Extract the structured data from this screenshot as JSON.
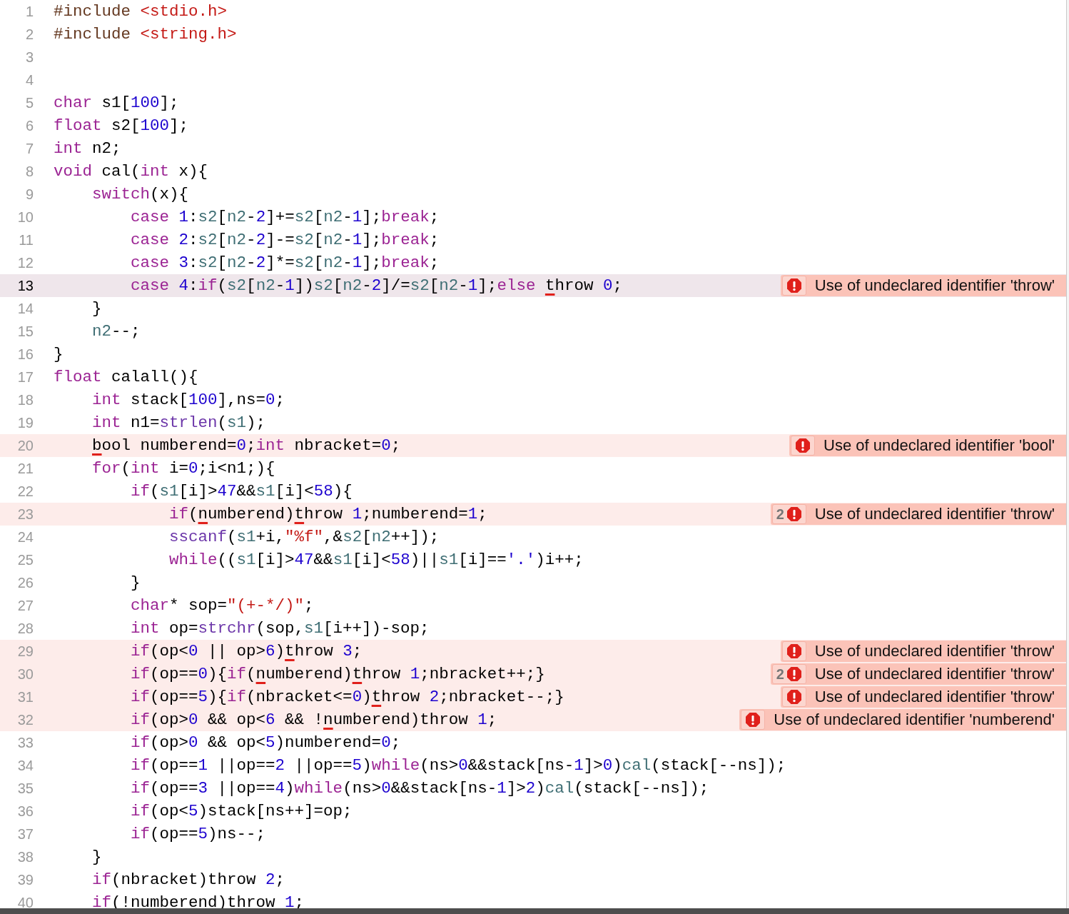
{
  "lines": [
    {
      "number": "1",
      "current": false,
      "tokens": [
        {
          "kind": "pp",
          "text": "#include "
        },
        {
          "kind": "str",
          "text": "<stdio.h>"
        }
      ]
    },
    {
      "number": "2",
      "current": false,
      "tokens": [
        {
          "kind": "pp",
          "text": "#include "
        },
        {
          "kind": "str",
          "text": "<string.h>"
        }
      ]
    },
    {
      "number": "3",
      "current": false
    },
    {
      "number": "4",
      "current": false
    },
    {
      "number": "5",
      "current": false,
      "tokens": [
        {
          "kind": "kw",
          "text": "char"
        },
        {
          "kind": "plain",
          "text": " s1["
        },
        {
          "kind": "num",
          "text": "100"
        },
        {
          "kind": "plain",
          "text": "];"
        }
      ]
    },
    {
      "number": "6",
      "current": false,
      "tokens": [
        {
          "kind": "kw",
          "text": "float"
        },
        {
          "kind": "plain",
          "text": " s2["
        },
        {
          "kind": "num",
          "text": "100"
        },
        {
          "kind": "plain",
          "text": "];"
        }
      ]
    },
    {
      "number": "7",
      "current": false,
      "tokens": [
        {
          "kind": "kw",
          "text": "int"
        },
        {
          "kind": "plain",
          "text": " n2;"
        }
      ]
    },
    {
      "number": "8",
      "current": false,
      "tokens": [
        {
          "kind": "kw",
          "text": "void"
        },
        {
          "kind": "plain",
          "text": " cal("
        },
        {
          "kind": "kw",
          "text": "int"
        },
        {
          "kind": "plain",
          "text": " x){"
        }
      ]
    },
    {
      "number": "9",
      "current": false,
      "tokens": [
        {
          "kind": "kw",
          "text": "    switch"
        },
        {
          "kind": "plain",
          "text": "(x){"
        }
      ]
    },
    {
      "number": "10",
      "current": false,
      "tokens": [
        {
          "kind": "kw",
          "text": "        case "
        },
        {
          "kind": "num",
          "text": "1"
        },
        {
          "kind": "plain",
          "text": ":"
        },
        {
          "kind": "id",
          "text": "s2"
        },
        {
          "kind": "plain",
          "text": "["
        },
        {
          "kind": "id",
          "text": "n2"
        },
        {
          "kind": "plain",
          "text": "-"
        },
        {
          "kind": "num",
          "text": "2"
        },
        {
          "kind": "plain",
          "text": "]+="
        },
        {
          "kind": "id",
          "text": "s2"
        },
        {
          "kind": "plain",
          "text": "["
        },
        {
          "kind": "id",
          "text": "n2"
        },
        {
          "kind": "plain",
          "text": "-"
        },
        {
          "kind": "num",
          "text": "1"
        },
        {
          "kind": "plain",
          "text": "];"
        },
        {
          "kind": "kw",
          "text": "break"
        },
        {
          "kind": "plain",
          "text": ";"
        }
      ]
    },
    {
      "number": "11",
      "current": false,
      "tokens": [
        {
          "kind": "kw",
          "text": "        case "
        },
        {
          "kind": "num",
          "text": "2"
        },
        {
          "kind": "plain",
          "text": ":"
        },
        {
          "kind": "id",
          "text": "s2"
        },
        {
          "kind": "plain",
          "text": "["
        },
        {
          "kind": "id",
          "text": "n2"
        },
        {
          "kind": "plain",
          "text": "-"
        },
        {
          "kind": "num",
          "text": "2"
        },
        {
          "kind": "plain",
          "text": "]-="
        },
        {
          "kind": "id",
          "text": "s2"
        },
        {
          "kind": "plain",
          "text": "["
        },
        {
          "kind": "id",
          "text": "n2"
        },
        {
          "kind": "plain",
          "text": "-"
        },
        {
          "kind": "num",
          "text": "1"
        },
        {
          "kind": "plain",
          "text": "];"
        },
        {
          "kind": "kw",
          "text": "break"
        },
        {
          "kind": "plain",
          "text": ";"
        }
      ]
    },
    {
      "number": "12",
      "current": false,
      "tokens": [
        {
          "kind": "kw",
          "text": "        case "
        },
        {
          "kind": "num",
          "text": "3"
        },
        {
          "kind": "plain",
          "text": ":"
        },
        {
          "kind": "id",
          "text": "s2"
        },
        {
          "kind": "plain",
          "text": "["
        },
        {
          "kind": "id",
          "text": "n2"
        },
        {
          "kind": "plain",
          "text": "-"
        },
        {
          "kind": "num",
          "text": "2"
        },
        {
          "kind": "plain",
          "text": "]*="
        },
        {
          "kind": "id",
          "text": "s2"
        },
        {
          "kind": "plain",
          "text": "["
        },
        {
          "kind": "id",
          "text": "n2"
        },
        {
          "kind": "plain",
          "text": "-"
        },
        {
          "kind": "num",
          "text": "1"
        },
        {
          "kind": "plain",
          "text": "];"
        },
        {
          "kind": "kw",
          "text": "break"
        },
        {
          "kind": "plain",
          "text": ";"
        }
      ]
    },
    {
      "number": "13",
      "current": true,
      "error": {
        "message": "Use of undeclared identifier 'throw'"
      },
      "tokens": [
        {
          "kind": "kw",
          "text": "        case "
        },
        {
          "kind": "num",
          "text": "4"
        },
        {
          "kind": "plain",
          "text": ":"
        },
        {
          "kind": "kw",
          "text": "if"
        },
        {
          "kind": "plain",
          "text": "("
        },
        {
          "kind": "id",
          "text": "s2"
        },
        {
          "kind": "plain",
          "text": "["
        },
        {
          "kind": "id",
          "text": "n2"
        },
        {
          "kind": "plain",
          "text": "-"
        },
        {
          "kind": "num",
          "text": "1"
        },
        {
          "kind": "plain",
          "text": "])"
        },
        {
          "kind": "id",
          "text": "s2"
        },
        {
          "kind": "plain",
          "text": "["
        },
        {
          "kind": "id",
          "text": "n2"
        },
        {
          "kind": "plain",
          "text": "-"
        },
        {
          "kind": "num",
          "text": "2"
        },
        {
          "kind": "plain",
          "text": "]/="
        },
        {
          "kind": "id",
          "text": "s2"
        },
        {
          "kind": "plain",
          "text": "["
        },
        {
          "kind": "id",
          "text": "n2"
        },
        {
          "kind": "plain",
          "text": "-"
        },
        {
          "kind": "num",
          "text": "1"
        },
        {
          "kind": "plain",
          "text": "];"
        },
        {
          "kind": "kw",
          "text": "else "
        },
        {
          "kind": "flag",
          "text": "t"
        },
        {
          "kind": "plain",
          "text": "hrow "
        },
        {
          "kind": "num",
          "text": "0"
        },
        {
          "kind": "plain",
          "text": ";"
        }
      ]
    },
    {
      "number": "14",
      "current": false,
      "tokens": [
        {
          "kind": "plain",
          "text": "    }"
        }
      ]
    },
    {
      "number": "15",
      "current": false,
      "tokens": [
        {
          "kind": "id",
          "text": "    n2"
        },
        {
          "kind": "plain",
          "text": "--;"
        }
      ]
    },
    {
      "number": "16",
      "current": false,
      "tokens": [
        {
          "kind": "plain",
          "text": "}"
        }
      ]
    },
    {
      "number": "17",
      "current": false,
      "tokens": [
        {
          "kind": "kw",
          "text": "float"
        },
        {
          "kind": "plain",
          "text": " calall(){"
        }
      ]
    },
    {
      "number": "18",
      "current": false,
      "tokens": [
        {
          "kind": "kw",
          "text": "    int"
        },
        {
          "kind": "plain",
          "text": " stack["
        },
        {
          "kind": "num",
          "text": "100"
        },
        {
          "kind": "plain",
          "text": "],ns="
        },
        {
          "kind": "num",
          "text": "0"
        },
        {
          "kind": "plain",
          "text": ";"
        }
      ]
    },
    {
      "number": "19",
      "current": false,
      "tokens": [
        {
          "kind": "kw",
          "text": "    int"
        },
        {
          "kind": "plain",
          "text": " n1="
        },
        {
          "kind": "fn",
          "text": "strlen"
        },
        {
          "kind": "plain",
          "text": "("
        },
        {
          "kind": "id",
          "text": "s1"
        },
        {
          "kind": "plain",
          "text": ");"
        }
      ]
    },
    {
      "number": "20",
      "current": false,
      "error": {
        "message": "Use of undeclared identifier 'bool'"
      },
      "tokens": [
        {
          "kind": "flag",
          "text": "    b"
        },
        {
          "kind": "plain",
          "text": "ool numberend="
        },
        {
          "kind": "num",
          "text": "0"
        },
        {
          "kind": "plain",
          "text": ";"
        },
        {
          "kind": "kw",
          "text": "int"
        },
        {
          "kind": "plain",
          "text": " nbracket="
        },
        {
          "kind": "num",
          "text": "0"
        },
        {
          "kind": "plain",
          "text": ";"
        }
      ]
    },
    {
      "number": "21",
      "current": false,
      "tokens": [
        {
          "kind": "kw",
          "text": "    for"
        },
        {
          "kind": "plain",
          "text": "("
        },
        {
          "kind": "kw",
          "text": "int"
        },
        {
          "kind": "plain",
          "text": " i="
        },
        {
          "kind": "num",
          "text": "0"
        },
        {
          "kind": "plain",
          "text": ";i<n1;){"
        }
      ]
    },
    {
      "number": "22",
      "current": false,
      "tokens": [
        {
          "kind": "kw",
          "text": "        if"
        },
        {
          "kind": "plain",
          "text": "("
        },
        {
          "kind": "id",
          "text": "s1"
        },
        {
          "kind": "plain",
          "text": "[i]>"
        },
        {
          "kind": "num",
          "text": "47"
        },
        {
          "kind": "plain",
          "text": "&&"
        },
        {
          "kind": "id",
          "text": "s1"
        },
        {
          "kind": "plain",
          "text": "[i]<"
        },
        {
          "kind": "num",
          "text": "58"
        },
        {
          "kind": "plain",
          "text": "){"
        }
      ]
    },
    {
      "number": "23",
      "current": false,
      "error": {
        "count": "2",
        "message": "Use of undeclared identifier 'throw'"
      },
      "tokens": [
        {
          "kind": "kw",
          "text": "            if"
        },
        {
          "kind": "plain",
          "text": "("
        },
        {
          "kind": "flag",
          "text": "n"
        },
        {
          "kind": "plain",
          "text": "umberend)"
        },
        {
          "kind": "flag",
          "text": "t"
        },
        {
          "kind": "plain",
          "text": "hrow "
        },
        {
          "kind": "num",
          "text": "1"
        },
        {
          "kind": "plain",
          "text": ";numberend="
        },
        {
          "kind": "num",
          "text": "1"
        },
        {
          "kind": "plain",
          "text": ";"
        }
      ]
    },
    {
      "number": "24",
      "current": false,
      "tokens": [
        {
          "kind": "fn",
          "text": "            sscanf"
        },
        {
          "kind": "plain",
          "text": "("
        },
        {
          "kind": "id",
          "text": "s1"
        },
        {
          "kind": "plain",
          "text": "+i,"
        },
        {
          "kind": "str",
          "text": "\"%f\""
        },
        {
          "kind": "plain",
          "text": ",&"
        },
        {
          "kind": "id",
          "text": "s2"
        },
        {
          "kind": "plain",
          "text": "["
        },
        {
          "kind": "id",
          "text": "n2"
        },
        {
          "kind": "plain",
          "text": "++]);"
        }
      ]
    },
    {
      "number": "25",
      "current": false,
      "tokens": [
        {
          "kind": "kw",
          "text": "            while"
        },
        {
          "kind": "plain",
          "text": "(("
        },
        {
          "kind": "id",
          "text": "s1"
        },
        {
          "kind": "plain",
          "text": "[i]>"
        },
        {
          "kind": "num",
          "text": "47"
        },
        {
          "kind": "plain",
          "text": "&&"
        },
        {
          "kind": "id",
          "text": "s1"
        },
        {
          "kind": "plain",
          "text": "[i]<"
        },
        {
          "kind": "num",
          "text": "58"
        },
        {
          "kind": "plain",
          "text": ")||"
        },
        {
          "kind": "id",
          "text": "s1"
        },
        {
          "kind": "plain",
          "text": "[i]=="
        },
        {
          "kind": "char",
          "text": "'.'"
        },
        {
          "kind": "plain",
          "text": ")i++;"
        }
      ]
    },
    {
      "number": "26",
      "current": false,
      "tokens": [
        {
          "kind": "plain",
          "text": "        }"
        }
      ]
    },
    {
      "number": "27",
      "current": false,
      "tokens": [
        {
          "kind": "kw",
          "text": "        char"
        },
        {
          "kind": "plain",
          "text": "* sop="
        },
        {
          "kind": "str",
          "text": "\"(+-*/)\""
        },
        {
          "kind": "plain",
          "text": ";"
        }
      ]
    },
    {
      "number": "28",
      "current": false,
      "tokens": [
        {
          "kind": "kw",
          "text": "        int"
        },
        {
          "kind": "plain",
          "text": " op="
        },
        {
          "kind": "fn",
          "text": "strchr"
        },
        {
          "kind": "plain",
          "text": "(sop,"
        },
        {
          "kind": "id",
          "text": "s1"
        },
        {
          "kind": "plain",
          "text": "[i++])-sop;"
        }
      ]
    },
    {
      "number": "29",
      "current": false,
      "error": {
        "message": "Use of undeclared identifier 'throw'"
      },
      "tokens": [
        {
          "kind": "kw",
          "text": "        if"
        },
        {
          "kind": "plain",
          "text": "(op<"
        },
        {
          "kind": "num",
          "text": "0"
        },
        {
          "kind": "plain",
          "text": " || op>"
        },
        {
          "kind": "num",
          "text": "6"
        },
        {
          "kind": "plain",
          "text": ")"
        },
        {
          "kind": "flag",
          "text": "t"
        },
        {
          "kind": "plain",
          "text": "hrow "
        },
        {
          "kind": "num",
          "text": "3"
        },
        {
          "kind": "plain",
          "text": ";"
        }
      ]
    },
    {
      "number": "30",
      "current": false,
      "error": {
        "count": "2",
        "message": "Use of undeclared identifier 'throw'"
      },
      "tokens": [
        {
          "kind": "kw",
          "text": "        if"
        },
        {
          "kind": "plain",
          "text": "(op=="
        },
        {
          "kind": "num",
          "text": "0"
        },
        {
          "kind": "plain",
          "text": "){"
        },
        {
          "kind": "kw",
          "text": "if"
        },
        {
          "kind": "plain",
          "text": "("
        },
        {
          "kind": "flag",
          "text": "n"
        },
        {
          "kind": "plain",
          "text": "umberend)"
        },
        {
          "kind": "flag",
          "text": "t"
        },
        {
          "kind": "plain",
          "text": "hrow "
        },
        {
          "kind": "num",
          "text": "1"
        },
        {
          "kind": "plain",
          "text": ";nbracket++;}"
        }
      ]
    },
    {
      "number": "31",
      "current": false,
      "error": {
        "message": "Use of undeclared identifier 'throw'"
      },
      "tokens": [
        {
          "kind": "kw",
          "text": "        if"
        },
        {
          "kind": "plain",
          "text": "(op=="
        },
        {
          "kind": "num",
          "text": "5"
        },
        {
          "kind": "plain",
          "text": "){"
        },
        {
          "kind": "kw",
          "text": "if"
        },
        {
          "kind": "plain",
          "text": "(nbracket<="
        },
        {
          "kind": "num",
          "text": "0"
        },
        {
          "kind": "plain",
          "text": ")"
        },
        {
          "kind": "flag",
          "text": "t"
        },
        {
          "kind": "plain",
          "text": "hrow "
        },
        {
          "kind": "num",
          "text": "2"
        },
        {
          "kind": "plain",
          "text": ";nbracket--;}"
        }
      ]
    },
    {
      "number": "32",
      "current": false,
      "error": {
        "message": "Use of undeclared identifier 'numberend'"
      },
      "tokens": [
        {
          "kind": "kw",
          "text": "        if"
        },
        {
          "kind": "plain",
          "text": "(op>"
        },
        {
          "kind": "num",
          "text": "0"
        },
        {
          "kind": "plain",
          "text": " && op<"
        },
        {
          "kind": "num",
          "text": "6"
        },
        {
          "kind": "plain",
          "text": " && !"
        },
        {
          "kind": "flag",
          "text": "n"
        },
        {
          "kind": "plain",
          "text": "umberend)throw "
        },
        {
          "kind": "num",
          "text": "1"
        },
        {
          "kind": "plain",
          "text": ";"
        }
      ]
    },
    {
      "number": "33",
      "current": false,
      "tokens": [
        {
          "kind": "kw",
          "text": "        if"
        },
        {
          "kind": "plain",
          "text": "(op>"
        },
        {
          "kind": "num",
          "text": "0"
        },
        {
          "kind": "plain",
          "text": " && op<"
        },
        {
          "kind": "num",
          "text": "5"
        },
        {
          "kind": "plain",
          "text": ")numberend="
        },
        {
          "kind": "num",
          "text": "0"
        },
        {
          "kind": "plain",
          "text": ";"
        }
      ]
    },
    {
      "number": "34",
      "current": false,
      "tokens": [
        {
          "kind": "kw",
          "text": "        if"
        },
        {
          "kind": "plain",
          "text": "(op=="
        },
        {
          "kind": "num",
          "text": "1"
        },
        {
          "kind": "plain",
          "text": " ||op=="
        },
        {
          "kind": "num",
          "text": "2"
        },
        {
          "kind": "plain",
          "text": " ||op=="
        },
        {
          "kind": "num",
          "text": "5"
        },
        {
          "kind": "plain",
          "text": ")"
        },
        {
          "kind": "kw",
          "text": "while"
        },
        {
          "kind": "plain",
          "text": "(ns>"
        },
        {
          "kind": "num",
          "text": "0"
        },
        {
          "kind": "plain",
          "text": "&&stack[ns-"
        },
        {
          "kind": "num",
          "text": "1"
        },
        {
          "kind": "plain",
          "text": "]>"
        },
        {
          "kind": "num",
          "text": "0"
        },
        {
          "kind": "plain",
          "text": ")"
        },
        {
          "kind": "id",
          "text": "cal"
        },
        {
          "kind": "plain",
          "text": "(stack[--ns]);"
        }
      ]
    },
    {
      "number": "35",
      "current": false,
      "tokens": [
        {
          "kind": "kw",
          "text": "        if"
        },
        {
          "kind": "plain",
          "text": "(op=="
        },
        {
          "kind": "num",
          "text": "3"
        },
        {
          "kind": "plain",
          "text": " ||op=="
        },
        {
          "kind": "num",
          "text": "4"
        },
        {
          "kind": "plain",
          "text": ")"
        },
        {
          "kind": "kw",
          "text": "while"
        },
        {
          "kind": "plain",
          "text": "(ns>"
        },
        {
          "kind": "num",
          "text": "0"
        },
        {
          "kind": "plain",
          "text": "&&stack[ns-"
        },
        {
          "kind": "num",
          "text": "1"
        },
        {
          "kind": "plain",
          "text": "]>"
        },
        {
          "kind": "num",
          "text": "2"
        },
        {
          "kind": "plain",
          "text": ")"
        },
        {
          "kind": "id",
          "text": "cal"
        },
        {
          "kind": "plain",
          "text": "(stack[--ns]);"
        }
      ]
    },
    {
      "number": "36",
      "current": false,
      "tokens": [
        {
          "kind": "kw",
          "text": "        if"
        },
        {
          "kind": "plain",
          "text": "(op<"
        },
        {
          "kind": "num",
          "text": "5"
        },
        {
          "kind": "plain",
          "text": ")stack[ns++]=op;"
        }
      ]
    },
    {
      "number": "37",
      "current": false,
      "tokens": [
        {
          "kind": "kw",
          "text": "        if"
        },
        {
          "kind": "plain",
          "text": "(op=="
        },
        {
          "kind": "num",
          "text": "5"
        },
        {
          "kind": "plain",
          "text": ")ns--;"
        }
      ]
    },
    {
      "number": "38",
      "current": false,
      "tokens": [
        {
          "kind": "plain",
          "text": "    }"
        }
      ]
    },
    {
      "number": "39",
      "current": false,
      "tokens": [
        {
          "kind": "kw",
          "text": "    if"
        },
        {
          "kind": "plain",
          "text": "(nbracket)throw "
        },
        {
          "kind": "num",
          "text": "2"
        },
        {
          "kind": "plain",
          "text": ";"
        }
      ]
    },
    {
      "number": "40",
      "current": false,
      "tokens": [
        {
          "kind": "kw",
          "text": "    if"
        },
        {
          "kind": "plain",
          "text": "(!numberend)throw "
        },
        {
          "kind": "num",
          "text": "1"
        },
        {
          "kind": "plain",
          "text": ";"
        }
      ]
    }
  ]
}
